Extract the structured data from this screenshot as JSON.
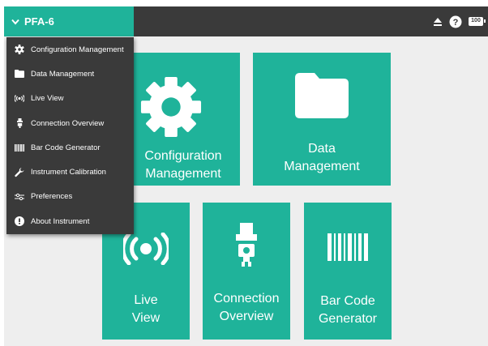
{
  "device": {
    "name": "PFA-6"
  },
  "status": {
    "battery": "100"
  },
  "menu": {
    "items": [
      {
        "label": "Configuration Management",
        "icon": "gear-icon"
      },
      {
        "label": "Data Management",
        "icon": "folder-icon"
      },
      {
        "label": "Live View",
        "icon": "broadcast-icon"
      },
      {
        "label": "Connection Overview",
        "icon": "plug-icon"
      },
      {
        "label": "Bar Code Generator",
        "icon": "barcode-icon"
      },
      {
        "label": "Instrument Calibration",
        "icon": "wrench-icon"
      },
      {
        "label": "Preferences",
        "icon": "sliders-icon"
      },
      {
        "label": "About Instrument",
        "icon": "alert-icon"
      }
    ]
  },
  "tiles": {
    "config": {
      "line1": "Configuration",
      "line2": "Management"
    },
    "data": {
      "line1": "Data",
      "line2": "Management"
    },
    "live": {
      "line1": "Live",
      "line2": "View"
    },
    "connect": {
      "line1": "Connection",
      "line2": "Overview"
    },
    "barcode": {
      "line1": "Bar Code",
      "line2": "Generator"
    }
  },
  "colors": {
    "accent": "#1fb39a",
    "toolbar": "#3a3a3a",
    "background": "#eeeeee"
  }
}
